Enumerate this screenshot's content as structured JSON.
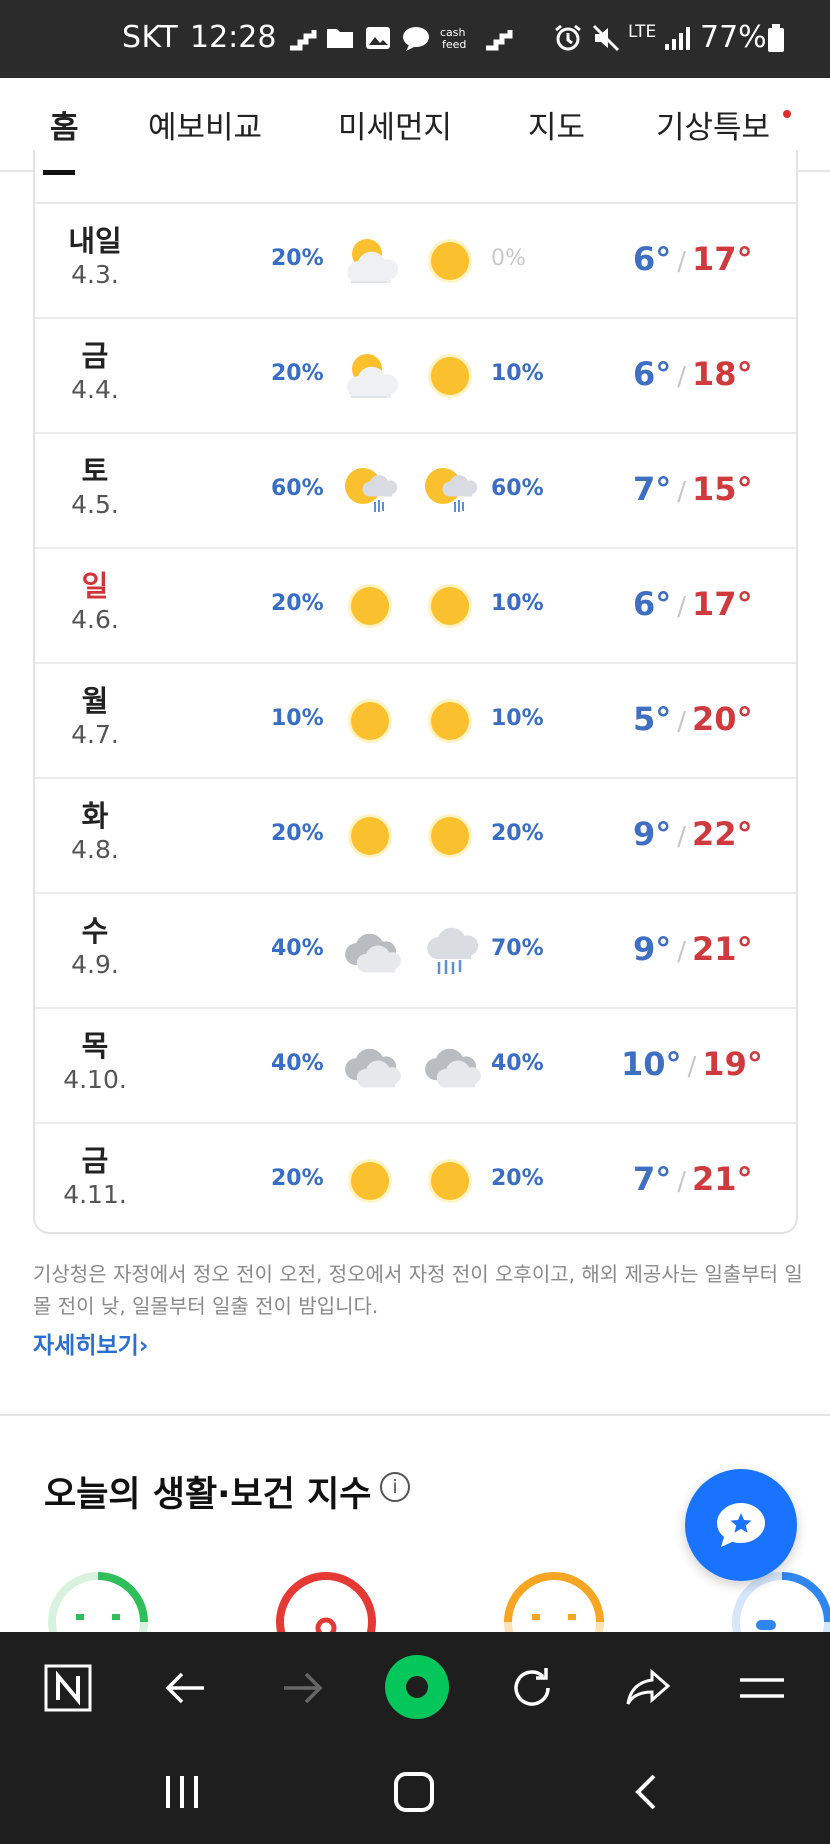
{
  "status_bar": {
    "carrier": "SKT",
    "time": "12:28",
    "network": "LTE",
    "battery": "77%"
  },
  "tabs": [
    {
      "label": "홈",
      "active": true
    },
    {
      "label": "예보비교"
    },
    {
      "label": "미세먼지"
    },
    {
      "label": "지도"
    },
    {
      "label": "기상특보",
      "has_alert_dot": true
    }
  ],
  "forecast": {
    "rows": [
      {
        "day": "내일",
        "date": "4.3.",
        "am_pct": "20%",
        "am_icon": "partly-cloudy-icon",
        "pm_icon": "sunny-icon",
        "pm_pct": "0%",
        "min": "6°",
        "max": "17°"
      },
      {
        "day": "금",
        "date": "4.4.",
        "am_pct": "20%",
        "am_icon": "partly-cloudy-icon",
        "pm_icon": "sunny-icon",
        "pm_pct": "10%",
        "min": "6°",
        "max": "18°"
      },
      {
        "day": "토",
        "date": "4.5.",
        "am_pct": "60%",
        "am_icon": "sun-cloud-rain-icon",
        "pm_icon": "sun-cloud-rain-icon",
        "pm_pct": "60%",
        "min": "7°",
        "max": "15°"
      },
      {
        "day": "일",
        "date": "4.6.",
        "am_pct": "20%",
        "am_icon": "sunny-icon",
        "pm_icon": "sunny-icon",
        "pm_pct": "10%",
        "min": "6°",
        "max": "17°",
        "holiday": true
      },
      {
        "day": "월",
        "date": "4.7.",
        "am_pct": "10%",
        "am_icon": "sunny-icon",
        "pm_icon": "sunny-icon",
        "pm_pct": "10%",
        "min": "5°",
        "max": "20°"
      },
      {
        "day": "화",
        "date": "4.8.",
        "am_pct": "20%",
        "am_icon": "sunny-icon",
        "pm_icon": "sunny-icon",
        "pm_pct": "20%",
        "min": "9°",
        "max": "22°"
      },
      {
        "day": "수",
        "date": "4.9.",
        "am_pct": "40%",
        "am_icon": "cloudy-icon",
        "pm_icon": "rain-icon",
        "pm_pct": "70%",
        "min": "9°",
        "max": "21°"
      },
      {
        "day": "목",
        "date": "4.10.",
        "am_pct": "40%",
        "am_icon": "cloudy-icon",
        "pm_icon": "cloudy-icon",
        "pm_pct": "40%",
        "min": "10°",
        "max": "19°"
      },
      {
        "day": "금",
        "date": "4.11.",
        "am_pct": "20%",
        "am_icon": "sunny-icon",
        "pm_icon": "sunny-icon",
        "pm_pct": "20%",
        "min": "7°",
        "max": "21°"
      }
    ],
    "temp_separator": "/"
  },
  "notice": {
    "text": "기상청은 자정에서 정오 전이 오전, 정오에서 자정 전이 오후이고, 해외 제공사는 일출부터 일몰 전이 낮, 일몰부터 일출 전이 밤입니다.",
    "link": "자세히보기"
  },
  "life_index": {
    "title": "오늘의 생활·보건 지수",
    "info": "i"
  },
  "colors": {
    "status_bg": "#2b2b2b",
    "min_temp": "#3e6fc2",
    "max_temp": "#cf3a3e",
    "precip": "#3a6ec4",
    "sun": "#fbc02d",
    "fab": "#1a73ff",
    "browser_bar": "#1e1e1e",
    "naver_green": "#03c75a"
  }
}
